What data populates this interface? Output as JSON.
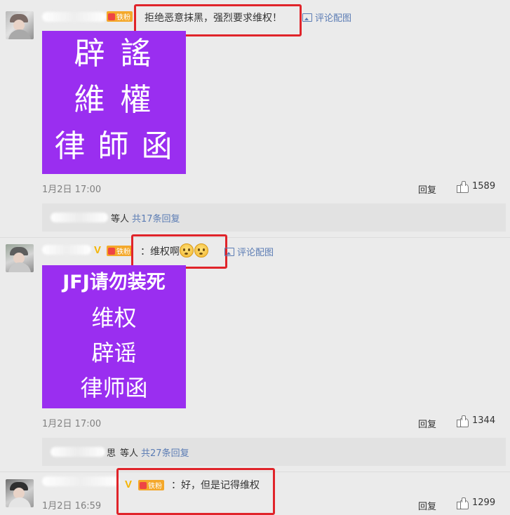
{
  "comments": [
    {
      "badge": "铁粉",
      "text": "拒绝恶意抹黑，强烈要求维权！",
      "pic_link": "评论配图",
      "image_lines": [
        "辟 謠",
        "維 權",
        "律 師 函"
      ],
      "time": "1月2日 17:00",
      "reply_label": "回复",
      "likes": "1589",
      "sub_prefix": "等人",
      "sub_link": "共17条回复"
    },
    {
      "badge": "铁粉",
      "text": "：维权啊",
      "pic_link": "评论配图",
      "image_lines": [
        "JFJ请勿装死",
        "维权",
        "辟谣",
        "律师函"
      ],
      "time": "1月2日 17:00",
      "reply_label": "回复",
      "likes": "1344",
      "sub_suffix_char": "思",
      "sub_prefix": "等人",
      "sub_link": "共27条回复"
    },
    {
      "badge": "铁粉",
      "text": "：好，但是记得维权",
      "time": "1月2日 16:59",
      "reply_label": "回复",
      "likes": "1299"
    }
  ],
  "colors": {
    "highlight": "#e0242a",
    "image_bg": "#9a2ef0",
    "link": "#5b7cb4",
    "badge": "#f4a82a"
  }
}
